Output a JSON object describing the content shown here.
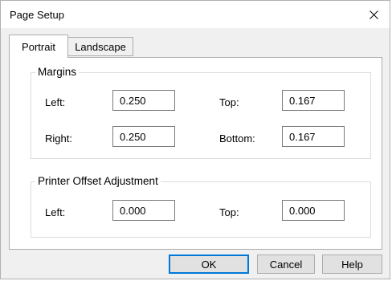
{
  "window": {
    "title": "Page Setup",
    "close_icon": "close-icon"
  },
  "tabs": [
    {
      "label": "Portrait",
      "active": true
    },
    {
      "label": "Landscape",
      "active": false
    }
  ],
  "margins": {
    "group_label": "Margins",
    "left": {
      "label": "Left:",
      "value": "0.250"
    },
    "top": {
      "label": "Top:",
      "value": "0.167"
    },
    "right": {
      "label": "Right:",
      "value": "0.250"
    },
    "bottom": {
      "label": "Bottom:",
      "value": "0.167"
    }
  },
  "offset": {
    "group_label": "Printer Offset Adjustment",
    "left": {
      "label": "Left:",
      "value": "0.000"
    },
    "top": {
      "label": "Top:",
      "value": "0.000"
    }
  },
  "buttons": {
    "ok": "OK",
    "cancel": "Cancel",
    "help": "Help"
  },
  "colors": {
    "default_button_border": "#0078d7",
    "panel_background": "#ffffff",
    "dialog_background": "#f0f0f0"
  }
}
